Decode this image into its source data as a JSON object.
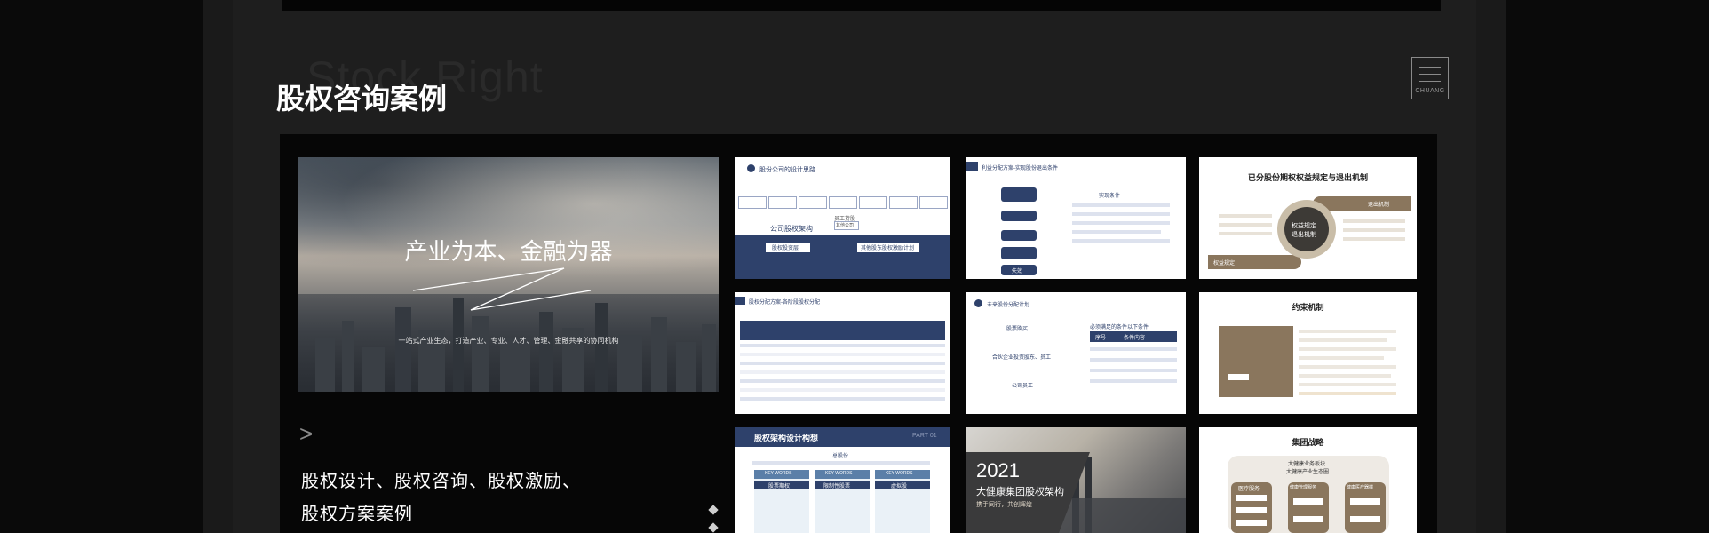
{
  "section": {
    "ghost_text": "Stock Right",
    "title": "股权咨询案例",
    "logo_text": "CHUANG"
  },
  "hero": {
    "title": "产业为本、金融为器",
    "subtitle": "一站式产业生态，打造产业、专业、人才、管理、金融共享的协同机构"
  },
  "description": {
    "arrow": ">",
    "line1": "股权设计、股权咨询、股权激励、",
    "line2": "股权方案案例"
  },
  "slides": {
    "s1": {
      "header": "股份公司的设计思路",
      "center": "公司股权架构",
      "box_left": "股权投资层",
      "box_right": "其他股东股权激励计划",
      "small": "员工持股",
      "pill": "其他公司"
    },
    "s2": {
      "header": "利益分配方案-实现股份退出条件",
      "right_title": "实现条件",
      "step_bottom": "失效"
    },
    "s3": {
      "title": "已分股份期权权益规定与退出机制",
      "circle_l1": "权益规定",
      "circle_l2": "退出机制",
      "tag_right": "退出机制",
      "tag_left": "权益规定"
    },
    "s4": {
      "header": "股权分配方案-各阶段股权分配"
    },
    "s5": {
      "header": "未来股份分配计划",
      "table_title": "必须满足的条件以下条件",
      "col1": "序号",
      "col2": "条件内容",
      "item1": "股票购买",
      "item2": "合伙企业投资股东、员工",
      "item3": "公司员工"
    },
    "s6": {
      "title": "约束机制"
    },
    "s7": {
      "title": "股权架构设计构想",
      "tag": "PART 01",
      "center": "总股份",
      "k1": "KEY WORDS",
      "k2": "KEY WORDS",
      "k3": "KEY WORDS",
      "t1": "股票期权",
      "t2": "限制性股票",
      "t3": "虚拟股"
    },
    "s8": {
      "year": "2021",
      "name": "大健康集团股权架构",
      "tagline": "携手同行，共创辉煌"
    },
    "s9": {
      "title": "集团战略",
      "center_l1": "大健康业务板块",
      "center_l2": "大健康产业生态圈",
      "b1": "医疗服务",
      "b2": "健康管理服务",
      "b3": "健康医疗器械"
    }
  }
}
